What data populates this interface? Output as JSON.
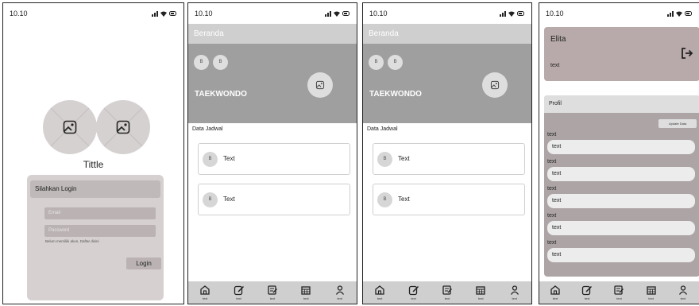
{
  "status": {
    "time": "10.10",
    "icons": "signal wifi battery"
  },
  "login": {
    "title": "Tittle",
    "panel_title": "Silahkan Login",
    "email_placeholder": "Email",
    "password_placeholder": "Password",
    "register_hint": "Belum memiliki akun, Daftar disini",
    "login_button": "Login"
  },
  "beranda": {
    "header_title": "Beranda",
    "mini_icons": [
      "B",
      "B"
    ],
    "hero_title": "TAEKWONDO",
    "section_label": "Data Jadwal",
    "items": [
      {
        "icon": "B",
        "text": "Text"
      },
      {
        "icon": "B",
        "text": "Text"
      }
    ]
  },
  "nav": [
    {
      "icon": "home-icon",
      "label": "text"
    },
    {
      "icon": "edit-icon",
      "label": "text"
    },
    {
      "icon": "notes-icon",
      "label": "text"
    },
    {
      "icon": "calendar-icon",
      "label": "text"
    },
    {
      "icon": "user-icon",
      "label": "text"
    }
  ],
  "profil": {
    "user_name": "Elita",
    "user_text": "text",
    "section_title": "Profil",
    "update_button": "Update Data",
    "fields": [
      {
        "label": "text",
        "value": "text"
      },
      {
        "label": "text",
        "value": "text"
      },
      {
        "label": "text",
        "value": "text"
      },
      {
        "label": "text",
        "value": "text"
      },
      {
        "label": "text",
        "value": "text"
      }
    ]
  },
  "colors": {
    "hero": "#9f9f9f",
    "header": "#cfcfcf",
    "login_card": "#d6d0d0",
    "profile_card": "#ada5a5",
    "user_card": "#b8aaaa"
  }
}
